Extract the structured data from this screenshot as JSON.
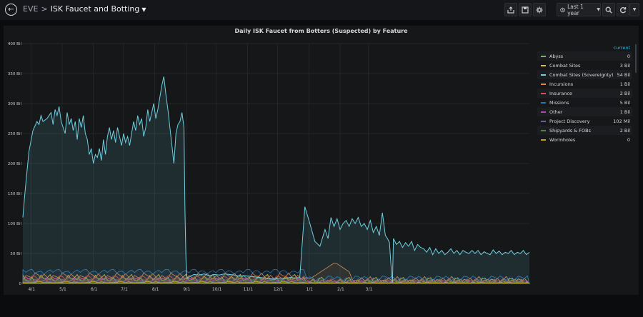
{
  "header": {
    "folder": "EVE",
    "separator": ">",
    "title": "ISK Faucet and Botting",
    "time_range_label": "Last 1 year"
  },
  "panel": {
    "title": "Daily ISK Faucet from Botters (Suspected) by Feature",
    "legend_header": "current"
  },
  "chart_data": {
    "type": "area",
    "title": "Daily ISK Faucet from Botters (Suspected) by Feature",
    "y_ticks": [
      "400 Bil",
      "350 Bil",
      "300 Bil",
      "250 Bil",
      "200 Bil",
      "150 Bil",
      "100 Bil",
      "50 Bil",
      "0"
    ],
    "ylim": [
      0,
      400
    ],
    "x_ticks": [
      "4/1",
      "5/1",
      "6/1",
      "7/1",
      "8/1",
      "9/1",
      "10/1",
      "11/1",
      "12/1",
      "1/1",
      "2/1",
      "3/1"
    ],
    "grid": true,
    "legend_position": "right",
    "series": [
      {
        "name": "Abyss",
        "current": "0",
        "color": "#7eb26d"
      },
      {
        "name": "Combat Sites",
        "current": "3 Bil",
        "color": "#eab839"
      },
      {
        "name": "Combat Sites (Sovereignty)",
        "current": "54 Bil",
        "color": "#6ed0e0",
        "points": [
          [
            0,
            110
          ],
          [
            2,
            150
          ],
          [
            6,
            220
          ],
          [
            10,
            255
          ],
          [
            14,
            270
          ],
          [
            16,
            265
          ],
          [
            18,
            280
          ],
          [
            20,
            270
          ],
          [
            24,
            275
          ],
          [
            28,
            285
          ],
          [
            30,
            265
          ],
          [
            32,
            290
          ],
          [
            34,
            280
          ],
          [
            36,
            295
          ],
          [
            38,
            270
          ],
          [
            40,
            260
          ],
          [
            42,
            250
          ],
          [
            44,
            285
          ],
          [
            46,
            265
          ],
          [
            48,
            275
          ],
          [
            50,
            255
          ],
          [
            52,
            270
          ],
          [
            54,
            240
          ],
          [
            56,
            275
          ],
          [
            58,
            260
          ],
          [
            60,
            280
          ],
          [
            62,
            250
          ],
          [
            64,
            240
          ],
          [
            66,
            215
          ],
          [
            68,
            225
          ],
          [
            70,
            200
          ],
          [
            72,
            215
          ],
          [
            74,
            210
          ],
          [
            76,
            225
          ],
          [
            78,
            205
          ],
          [
            80,
            240
          ],
          [
            82,
            215
          ],
          [
            84,
            245
          ],
          [
            86,
            260
          ],
          [
            88,
            240
          ],
          [
            90,
            255
          ],
          [
            92,
            235
          ],
          [
            94,
            260
          ],
          [
            96,
            245
          ],
          [
            98,
            230
          ],
          [
            100,
            250
          ],
          [
            102,
            235
          ],
          [
            104,
            245
          ],
          [
            106,
            230
          ],
          [
            108,
            250
          ],
          [
            110,
            270
          ],
          [
            112,
            255
          ],
          [
            114,
            280
          ],
          [
            116,
            265
          ],
          [
            118,
            275
          ],
          [
            120,
            245
          ],
          [
            122,
            260
          ],
          [
            124,
            290
          ],
          [
            126,
            270
          ],
          [
            128,
            285
          ],
          [
            130,
            300
          ],
          [
            132,
            275
          ],
          [
            134,
            290
          ],
          [
            136,
            310
          ],
          [
            138,
            330
          ],
          [
            140,
            345
          ],
          [
            142,
            315
          ],
          [
            144,
            290
          ],
          [
            146,
            260
          ],
          [
            148,
            230
          ],
          [
            150,
            200
          ],
          [
            152,
            250
          ],
          [
            154,
            265
          ],
          [
            156,
            270
          ],
          [
            158,
            285
          ],
          [
            160,
            260
          ],
          [
            161,
            120
          ],
          [
            162,
            40
          ],
          [
            163,
            8
          ],
          [
            166,
            12
          ],
          [
            170,
            15
          ],
          [
            175,
            14
          ],
          [
            180,
            16
          ],
          [
            185,
            13
          ],
          [
            190,
            15
          ],
          [
            195,
            14
          ],
          [
            200,
            16
          ],
          [
            205,
            15
          ],
          [
            210,
            14
          ],
          [
            215,
            12
          ],
          [
            220,
            13
          ],
          [
            225,
            12
          ],
          [
            230,
            11
          ],
          [
            235,
            10
          ],
          [
            240,
            9
          ],
          [
            245,
            8
          ],
          [
            250,
            7
          ],
          [
            255,
            9
          ],
          [
            260,
            8
          ],
          [
            265,
            10
          ],
          [
            270,
            9
          ],
          [
            275,
            10
          ],
          [
            280,
            128
          ],
          [
            285,
            100
          ],
          [
            290,
            70
          ],
          [
            295,
            62
          ],
          [
            300,
            90
          ],
          [
            303,
            75
          ],
          [
            306,
            110
          ],
          [
            309,
            95
          ],
          [
            312,
            108
          ],
          [
            315,
            90
          ],
          [
            318,
            100
          ],
          [
            321,
            105
          ],
          [
            324,
            95
          ],
          [
            327,
            108
          ],
          [
            330,
            100
          ],
          [
            333,
            110
          ],
          [
            336,
            95
          ],
          [
            339,
            100
          ],
          [
            342,
            90
          ],
          [
            345,
            105
          ],
          [
            348,
            85
          ],
          [
            351,
            95
          ],
          [
            354,
            80
          ],
          [
            357,
            118
          ],
          [
            360,
            80
          ],
          [
            362,
            75
          ],
          [
            364,
            68
          ],
          [
            366,
            20
          ],
          [
            367,
            2
          ],
          [
            368,
            75
          ],
          [
            371,
            65
          ],
          [
            374,
            70
          ],
          [
            377,
            60
          ],
          [
            380,
            68
          ],
          [
            383,
            62
          ],
          [
            386,
            70
          ],
          [
            389,
            55
          ],
          [
            392,
            65
          ],
          [
            395,
            60
          ],
          [
            398,
            58
          ],
          [
            401,
            52
          ],
          [
            404,
            60
          ],
          [
            407,
            48
          ],
          [
            410,
            58
          ],
          [
            413,
            50
          ],
          [
            416,
            55
          ],
          [
            419,
            48
          ],
          [
            422,
            52
          ],
          [
            425,
            58
          ],
          [
            428,
            50
          ],
          [
            431,
            55
          ],
          [
            434,
            48
          ],
          [
            437,
            55
          ],
          [
            440,
            52
          ],
          [
            443,
            50
          ],
          [
            446,
            55
          ],
          [
            449,
            50
          ],
          [
            452,
            55
          ],
          [
            455,
            48
          ],
          [
            458,
            53
          ],
          [
            461,
            50
          ],
          [
            464,
            48
          ],
          [
            467,
            56
          ],
          [
            470,
            50
          ],
          [
            473,
            54
          ],
          [
            476,
            48
          ],
          [
            479,
            52
          ],
          [
            482,
            50
          ],
          [
            485,
            55
          ],
          [
            488,
            48
          ],
          [
            491,
            52
          ],
          [
            494,
            50
          ],
          [
            497,
            55
          ],
          [
            500,
            48
          ],
          [
            503,
            52
          ]
        ]
      },
      {
        "name": "Incursions",
        "current": "1 Bil",
        "color": "#ef843c"
      },
      {
        "name": "Insurance",
        "current": "2 Bil",
        "color": "#e24d42"
      },
      {
        "name": "Missions",
        "current": "5 Bil",
        "color": "#1f78c1"
      },
      {
        "name": "Other",
        "current": "1 Bil",
        "color": "#ba43a9"
      },
      {
        "name": "Project Discovery",
        "current": "102 Mil",
        "color": "#705da0"
      },
      {
        "name": "Shipyards & FOBs",
        "current": "2 Bil",
        "color": "#508642"
      },
      {
        "name": "Wormholes",
        "current": "0",
        "color": "#cca300"
      }
    ]
  }
}
